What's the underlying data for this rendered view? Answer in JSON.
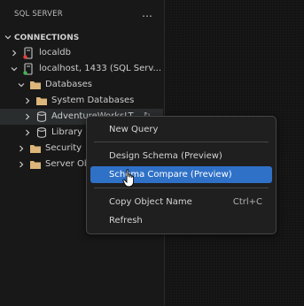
{
  "panel": {
    "title": "SQL SERVER",
    "more_icon": "…"
  },
  "section": {
    "label": "CONNECTIONS"
  },
  "tree": {
    "localdb": "localdb",
    "localhost": "localhost, 1433 (SQL Serv...",
    "databases": "Databases",
    "system_databases": "System Databases",
    "adventureworks": "AdventureWorksLT",
    "adventureworks_extra": "↻",
    "library": "Library",
    "security": "Security",
    "server_objects": "Server Objects"
  },
  "menu": {
    "new_query": "New Query",
    "design_schema": "Design Schema (Preview)",
    "schema_compare": "Schema Compare (Preview)",
    "copy_object_name": "Copy Object Name",
    "copy_object_name_shortcut": "Ctrl+C",
    "refresh": "Refresh"
  },
  "colors": {
    "background": "#181818",
    "menu_background": "#1f1f1f",
    "menu_highlight": "#2f71c7",
    "folder": "#dcb67a"
  }
}
